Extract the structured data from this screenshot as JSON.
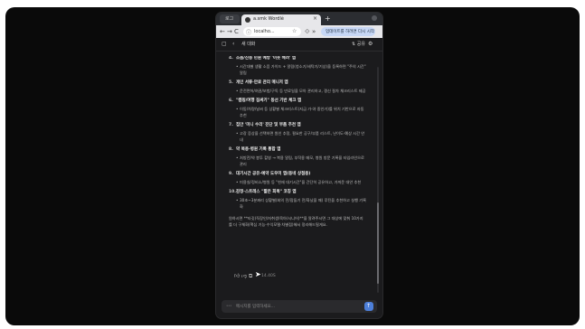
{
  "browser": {
    "inactive_tab": "로그",
    "active_tab_title": "a.smk Wordlé",
    "url": "localho...",
    "extension_button": "업데이트를 하려면 다시 시작",
    "nav": {
      "back": "←",
      "forward": "→",
      "reload": "C"
    }
  },
  "app": {
    "header_title": "새 대화",
    "share_label": "공유"
  },
  "content": {
    "items": [
      {
        "num": "4.",
        "title": "소음/진동 민원 예방 '이웃 배려' 앱",
        "desc": "시간대별 생활 소음 가이드 + 알림(청소기/세탁기/기상)을 등록하면 \"주의 시간\" 알림"
      },
      {
        "num": "5.",
        "title": "개인 서류·만료 관리 매니저 앱",
        "desc": "운전면허/여권/보험/구독 등 만료일을 모아 관리하고, 갱신 절차 체크리스트 제공"
      },
      {
        "num": "6.",
        "title": "\"캠핑/여행 짐싸기\" 동선 기반 체크 앱",
        "desc": "이동/차량/날씨 등 상황별 체크리스트(지금 가·야 중인가)를 위치 기반으로 자동 추천"
      },
      {
        "num": "7.",
        "title": "집안 '미니 수리' 진단 및 부품 추천 앱",
        "desc": "고장 증상을 선택하면 원인 추정, 필요한 공구/부품 리스트, 난이도·예상 시간 안내"
      },
      {
        "num": "8.",
        "title": "약 복용·병원 기록 통합 앱",
        "desc": "처방전/약 봉투 촬영 → 복용 알림, 부작용 메모, 병원 방문 기록을 타임라인으로 관리"
      },
      {
        "num": "9.",
        "title": "대기시간 공유·예약 도우미 앱(동네 상점용)",
        "desc": "미용실/정비소/병원 등 \"현재 대기시간\"을 간단히 공유하고, 가까운 대안 추천"
      },
      {
        "num": "10.",
        "title": "감정·스트레스 \"짧은 회복\" 코칭 앱",
        "desc": "30초~3분짜리 상황별(회의 전/잠들기 전/화났을 때) 루틴을 추천하고 실행 기록화"
      }
    ],
    "summary": "원하시면 **타깃(직장인/자취생/육아/시니어)**을 알려주시면 그 대상에 맞춰 10가지를 더 구체화(핵심 기능·수익모델·차별점)해서 정리해드릴게요.",
    "timestamp": "14.40S"
  },
  "input": {
    "placeholder": "메시지를 입력하세요..."
  }
}
